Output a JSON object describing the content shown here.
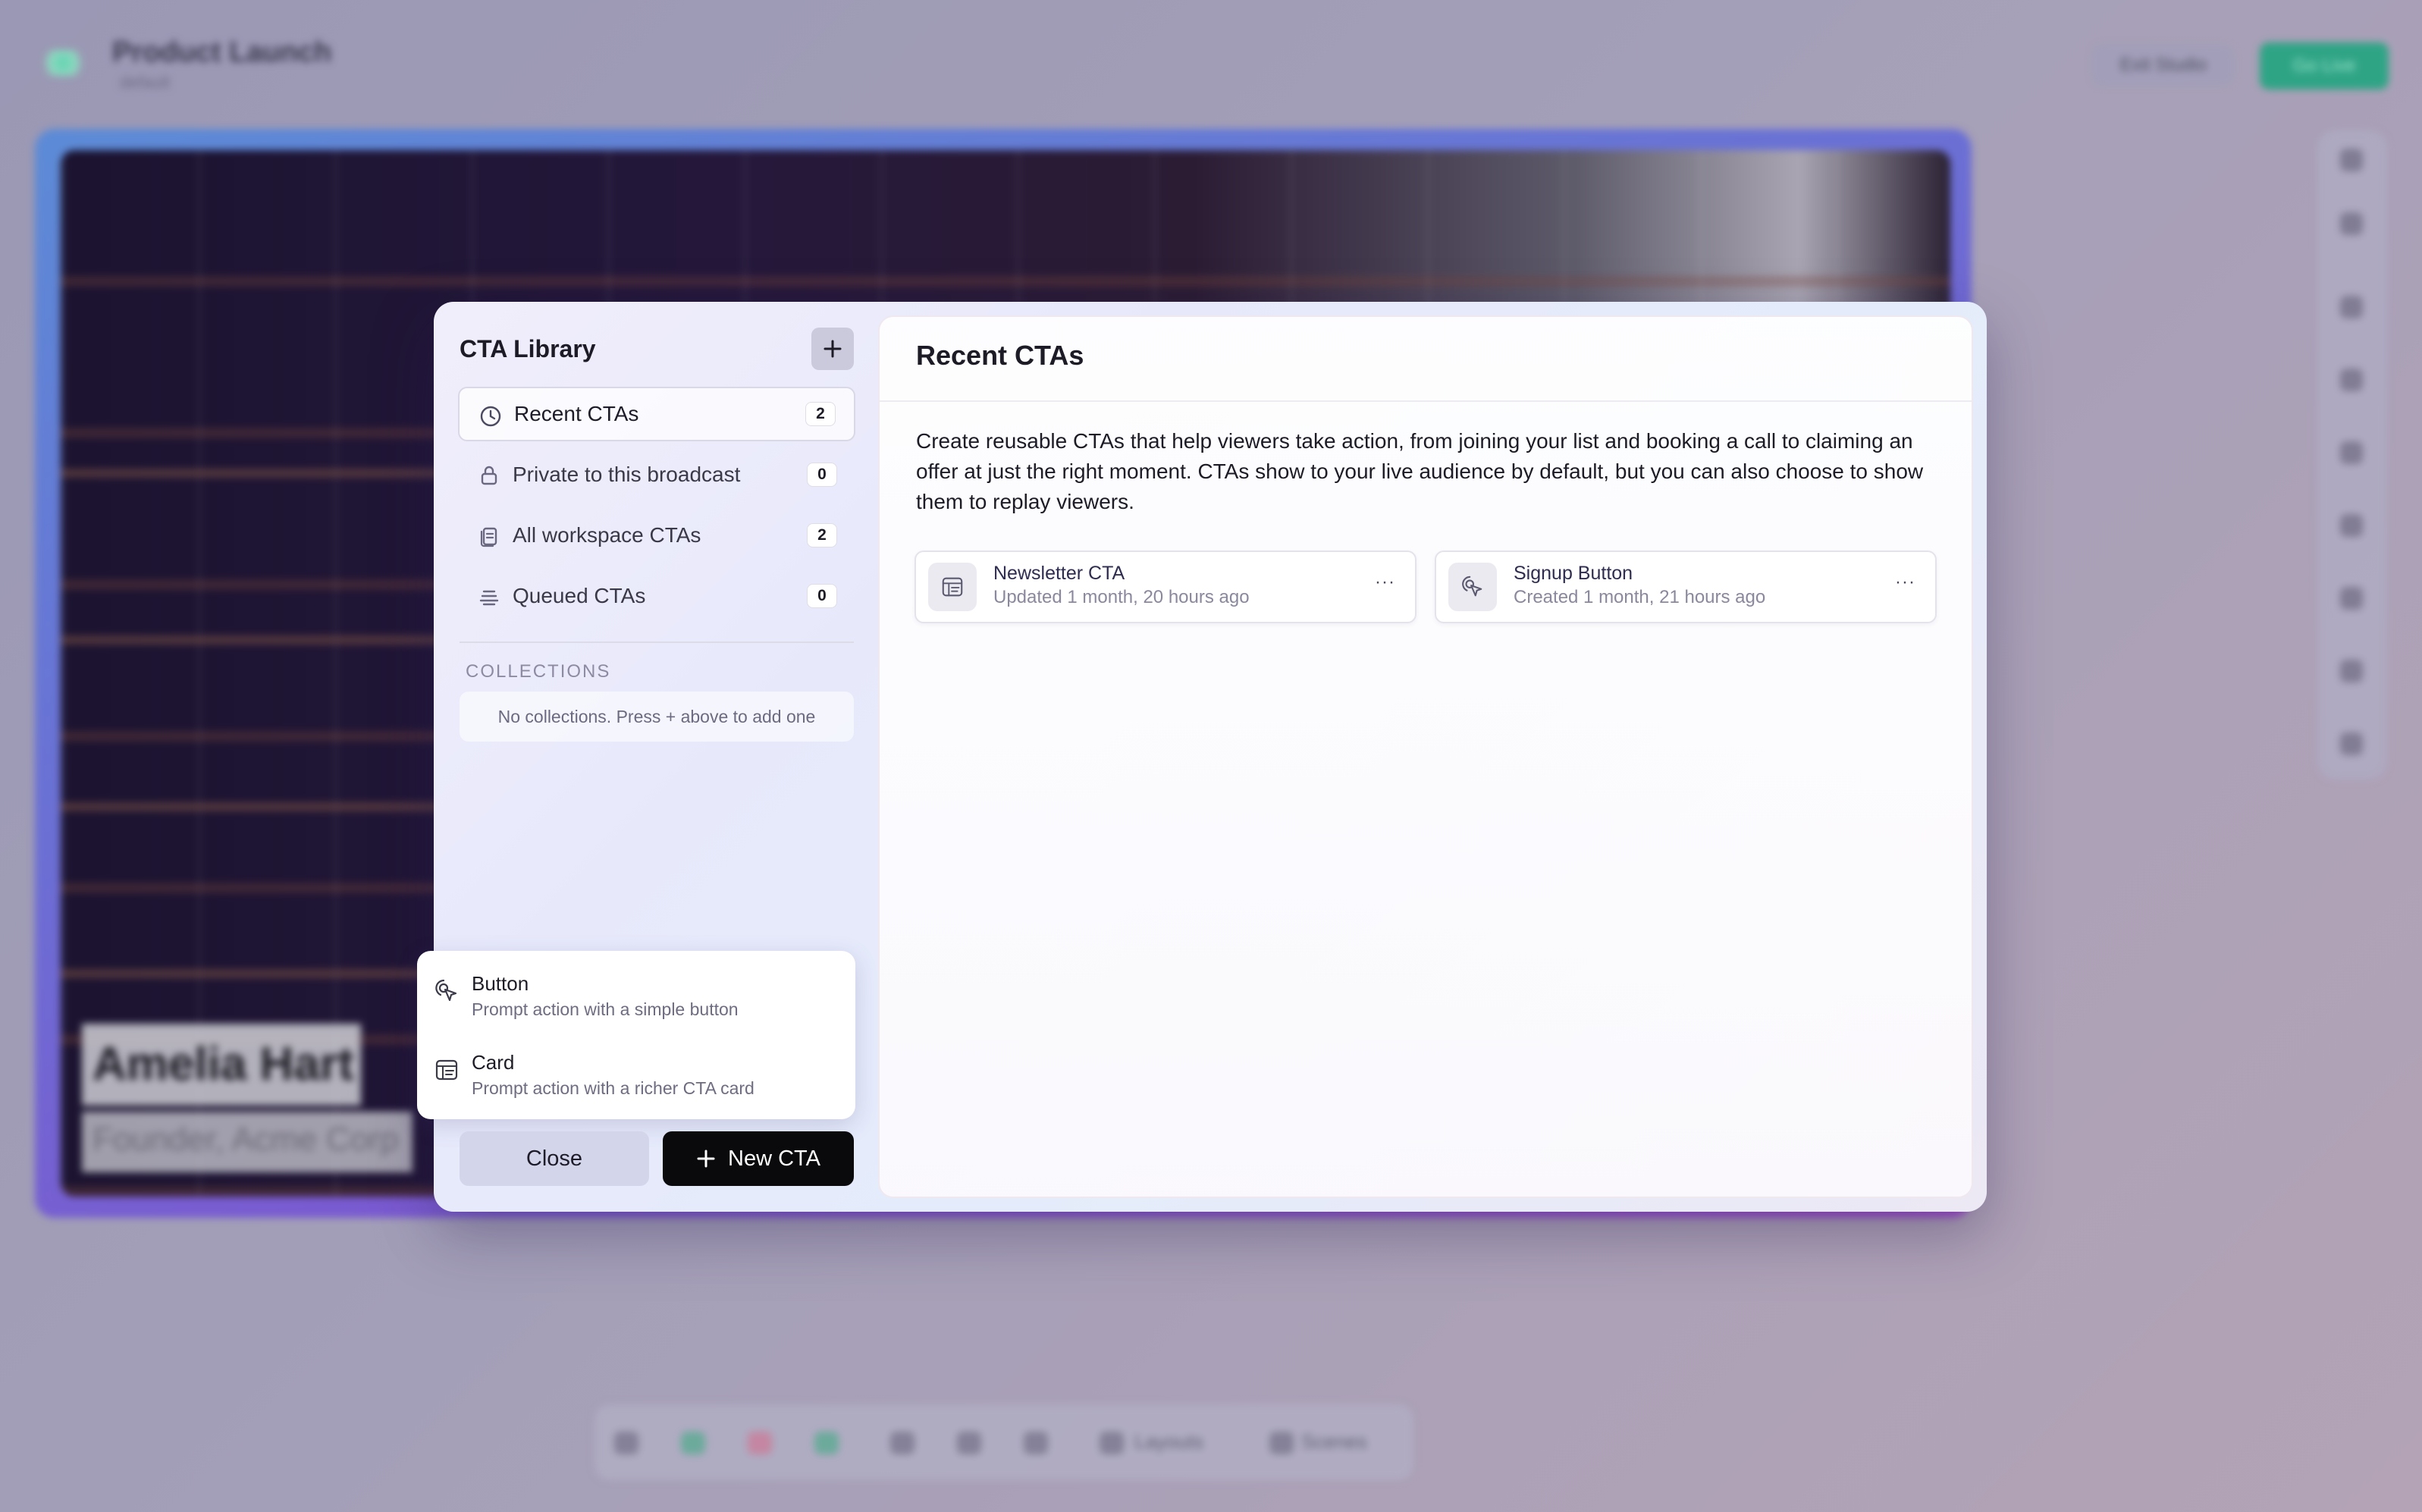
{
  "background": {
    "title": "Product Launch",
    "subtitle": "default",
    "exit_label": "Exit Studio",
    "go_live_label": "Go Live",
    "presenter_name": "Amelia Hart",
    "presenter_role": "Founder, Acme Corp",
    "bottom_bar": {
      "layouts_label": "Layouts",
      "scenes_label": "Scenes"
    }
  },
  "sidebar": {
    "title": "CTA Library",
    "nav": [
      {
        "label": "Recent CTAs",
        "count": "2",
        "icon": "clock-icon",
        "active": true
      },
      {
        "label": "Private to this broadcast",
        "count": "0",
        "icon": "lock-icon",
        "active": false
      },
      {
        "label": "All workspace CTAs",
        "count": "2",
        "icon": "files-icon",
        "active": false
      },
      {
        "label": "Queued CTAs",
        "count": "0",
        "icon": "stack-icon",
        "active": false
      }
    ],
    "collections_title": "COLLECTIONS",
    "collections_empty": "No collections. Press + above to add one"
  },
  "dropdown": {
    "items": [
      {
        "label": "Button",
        "desc": "Prompt action with a simple button",
        "icon": "pointer-icon"
      },
      {
        "label": "Card",
        "desc": "Prompt action with a richer CTA card",
        "icon": "card-icon"
      }
    ]
  },
  "footer": {
    "close_label": "Close",
    "new_label": "New CTA"
  },
  "main": {
    "title": "Recent CTAs",
    "description": "Create reusable CTAs that help viewers take action, from joining your list and booking a call to claiming an offer at just the right moment. CTAs show to your live audience by default, but you can also choose to show them to replay viewers.",
    "ctas": [
      {
        "name": "Newsletter CTA",
        "meta": "Updated 1 month, 20 hours ago",
        "icon": "card-icon",
        "more": "···"
      },
      {
        "name": "Signup Button",
        "meta": "Created 1 month, 21 hours ago",
        "icon": "pointer-icon",
        "more": "···"
      }
    ]
  },
  "colors": {
    "accent": "#0a0a0c",
    "go_live": "#2fa485",
    "modal_bg": "#e7e9fb"
  }
}
